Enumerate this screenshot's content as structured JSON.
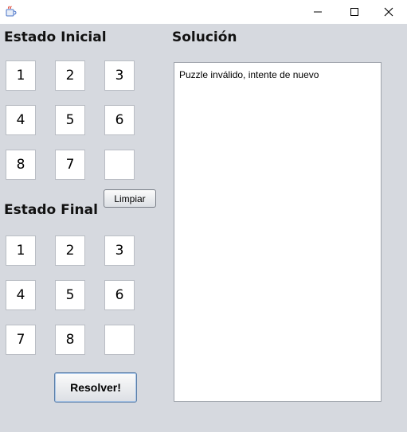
{
  "window": {
    "app_icon": "java-cup-icon",
    "controls": [
      "minimize-icon",
      "maximize-icon",
      "close-icon"
    ]
  },
  "initial": {
    "title": "Estado Inicial",
    "cells": [
      "1",
      "2",
      "3",
      "4",
      "5",
      "6",
      "8",
      "7",
      ""
    ]
  },
  "final": {
    "title": "Estado Final",
    "cells": [
      "1",
      "2",
      "3",
      "4",
      "5",
      "6",
      "7",
      "8",
      ""
    ]
  },
  "buttons": {
    "clear_label": "Limpiar",
    "solve_label": "Resolver!"
  },
  "solution": {
    "title": "Solución",
    "text": "Puzzle inválido, intente de nuevo"
  }
}
